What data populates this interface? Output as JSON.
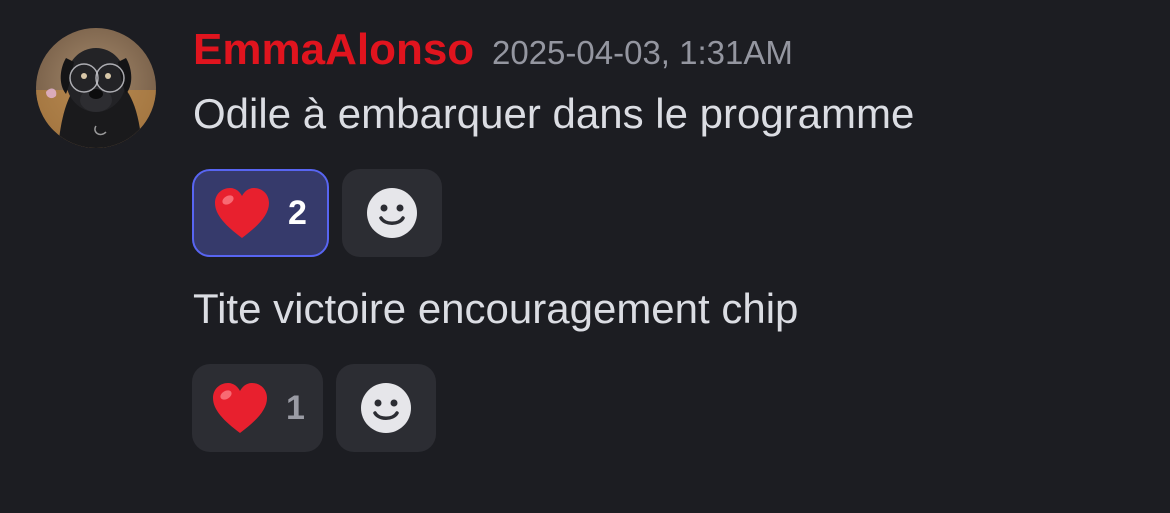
{
  "message": {
    "author": "EmmaAlonso",
    "author_color": "#e0141e",
    "timestamp": "2025-04-03, 1:31AM",
    "avatar_icon": "dog-avatar-icon",
    "lines": [
      {
        "text": "Odile à embarquer dans le programme",
        "reaction": {
          "emoji": "heart-emoji",
          "count": "2",
          "reacted_by_me": true
        }
      },
      {
        "text": "Tite victoire encouragement chip",
        "reaction": {
          "emoji": "heart-emoji",
          "count": "1",
          "reacted_by_me": false
        }
      }
    ],
    "add_reaction_icon": "smiley-add-reaction-icon"
  },
  "colors": {
    "background": "#1c1d22",
    "active_reaction_border": "#5865f2",
    "active_reaction_bg": "#363a6b",
    "reaction_bg": "#2c2d33",
    "heart": "#e8202e"
  }
}
